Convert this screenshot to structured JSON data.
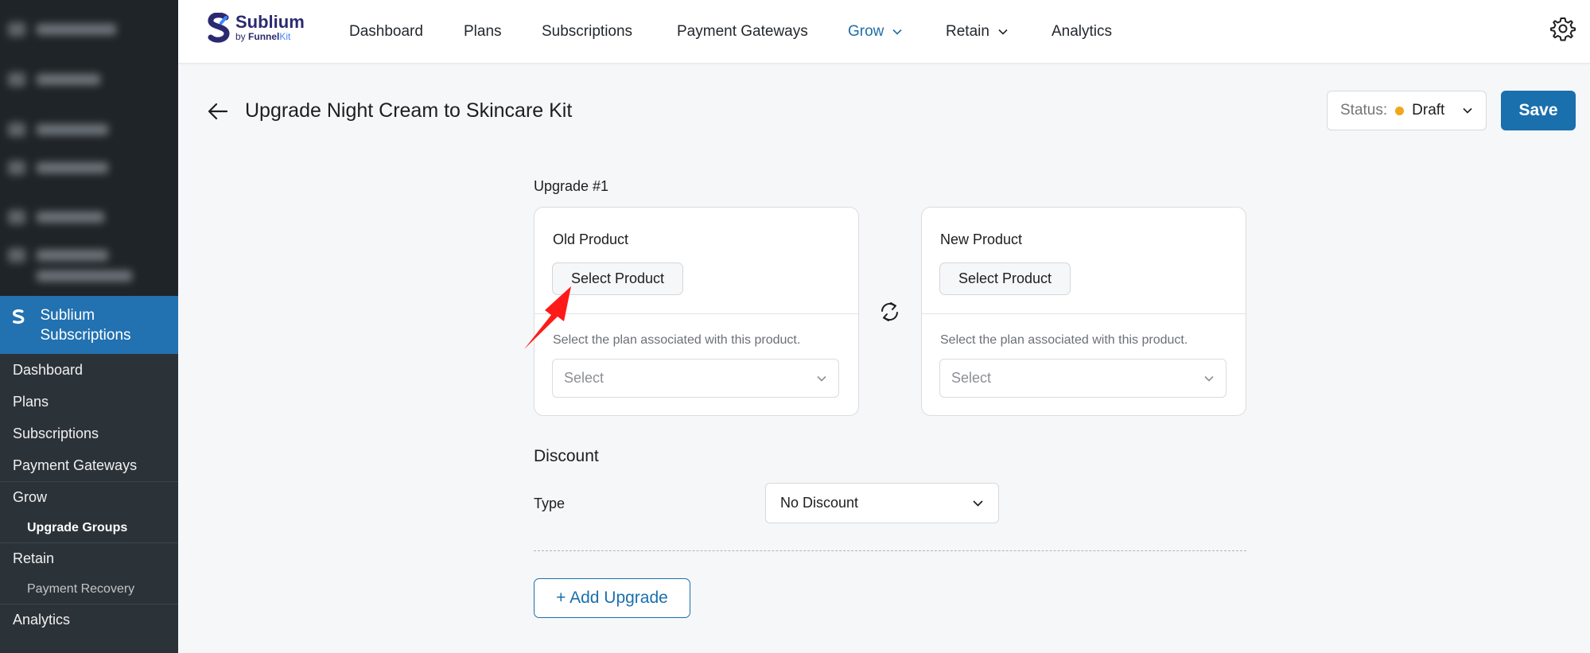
{
  "sidebar": {
    "current_menu": "Sublium Subscriptions",
    "items": [
      {
        "label": "Dashboard"
      },
      {
        "label": "Plans"
      },
      {
        "label": "Subscriptions"
      },
      {
        "label": "Payment Gateways"
      },
      {
        "label": "Grow"
      },
      {
        "label": "Upgrade Groups"
      },
      {
        "label": "Retain"
      },
      {
        "label": "Payment Recovery"
      },
      {
        "label": "Analytics"
      }
    ]
  },
  "topnav": {
    "brand": {
      "name": "Sublium",
      "by": "by",
      "funnel": "Funnel",
      "kit": "Kit"
    },
    "links": [
      {
        "label": "Dashboard"
      },
      {
        "label": "Plans"
      },
      {
        "label": "Subscriptions"
      },
      {
        "label": "Payment Gateways"
      },
      {
        "label": "Grow"
      },
      {
        "label": "Retain"
      },
      {
        "label": "Analytics"
      }
    ],
    "active": "Grow"
  },
  "header": {
    "title": "Upgrade Night Cream to Skincare Kit",
    "status_label": "Status:",
    "status_value": "Draft",
    "status_color": "#f0a71b",
    "save_label": "Save"
  },
  "upgrade": {
    "heading": "Upgrade #1",
    "old": {
      "title": "Old Product",
      "button": "Select Product",
      "hint": "Select the plan associated with this product.",
      "select_placeholder": "Select"
    },
    "new": {
      "title": "New Product",
      "button": "Select Product",
      "hint": "Select the plan associated with this product.",
      "select_placeholder": "Select"
    }
  },
  "discount": {
    "heading": "Discount",
    "type_label": "Type",
    "type_value": "No Discount"
  },
  "add_upgrade_label": "+ Add Upgrade",
  "colors": {
    "accent": "#1a6fad",
    "wp_highlight": "#2271b1",
    "annotation_arrow": "#ff1a1a"
  }
}
